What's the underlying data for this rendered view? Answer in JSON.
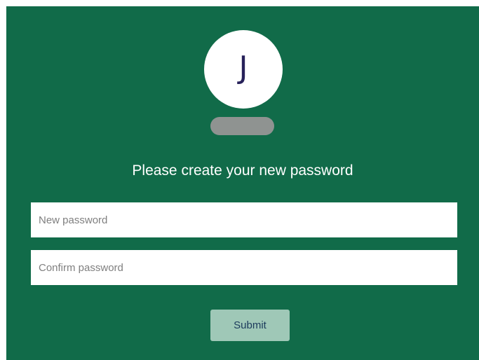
{
  "avatar": {
    "initial": "J"
  },
  "heading": "Please create your new password",
  "form": {
    "new_password": {
      "value": "",
      "placeholder": "New password"
    },
    "confirm_password": {
      "value": "",
      "placeholder": "Confirm password"
    },
    "submit_label": "Submit"
  },
  "colors": {
    "panel_background": "#116b49",
    "avatar_background": "#ffffff",
    "avatar_initial": "#27215a",
    "name_placeholder_pill": "#8f9391",
    "submit_background": "#9fc8b7",
    "submit_text": "#1c3b5c"
  }
}
